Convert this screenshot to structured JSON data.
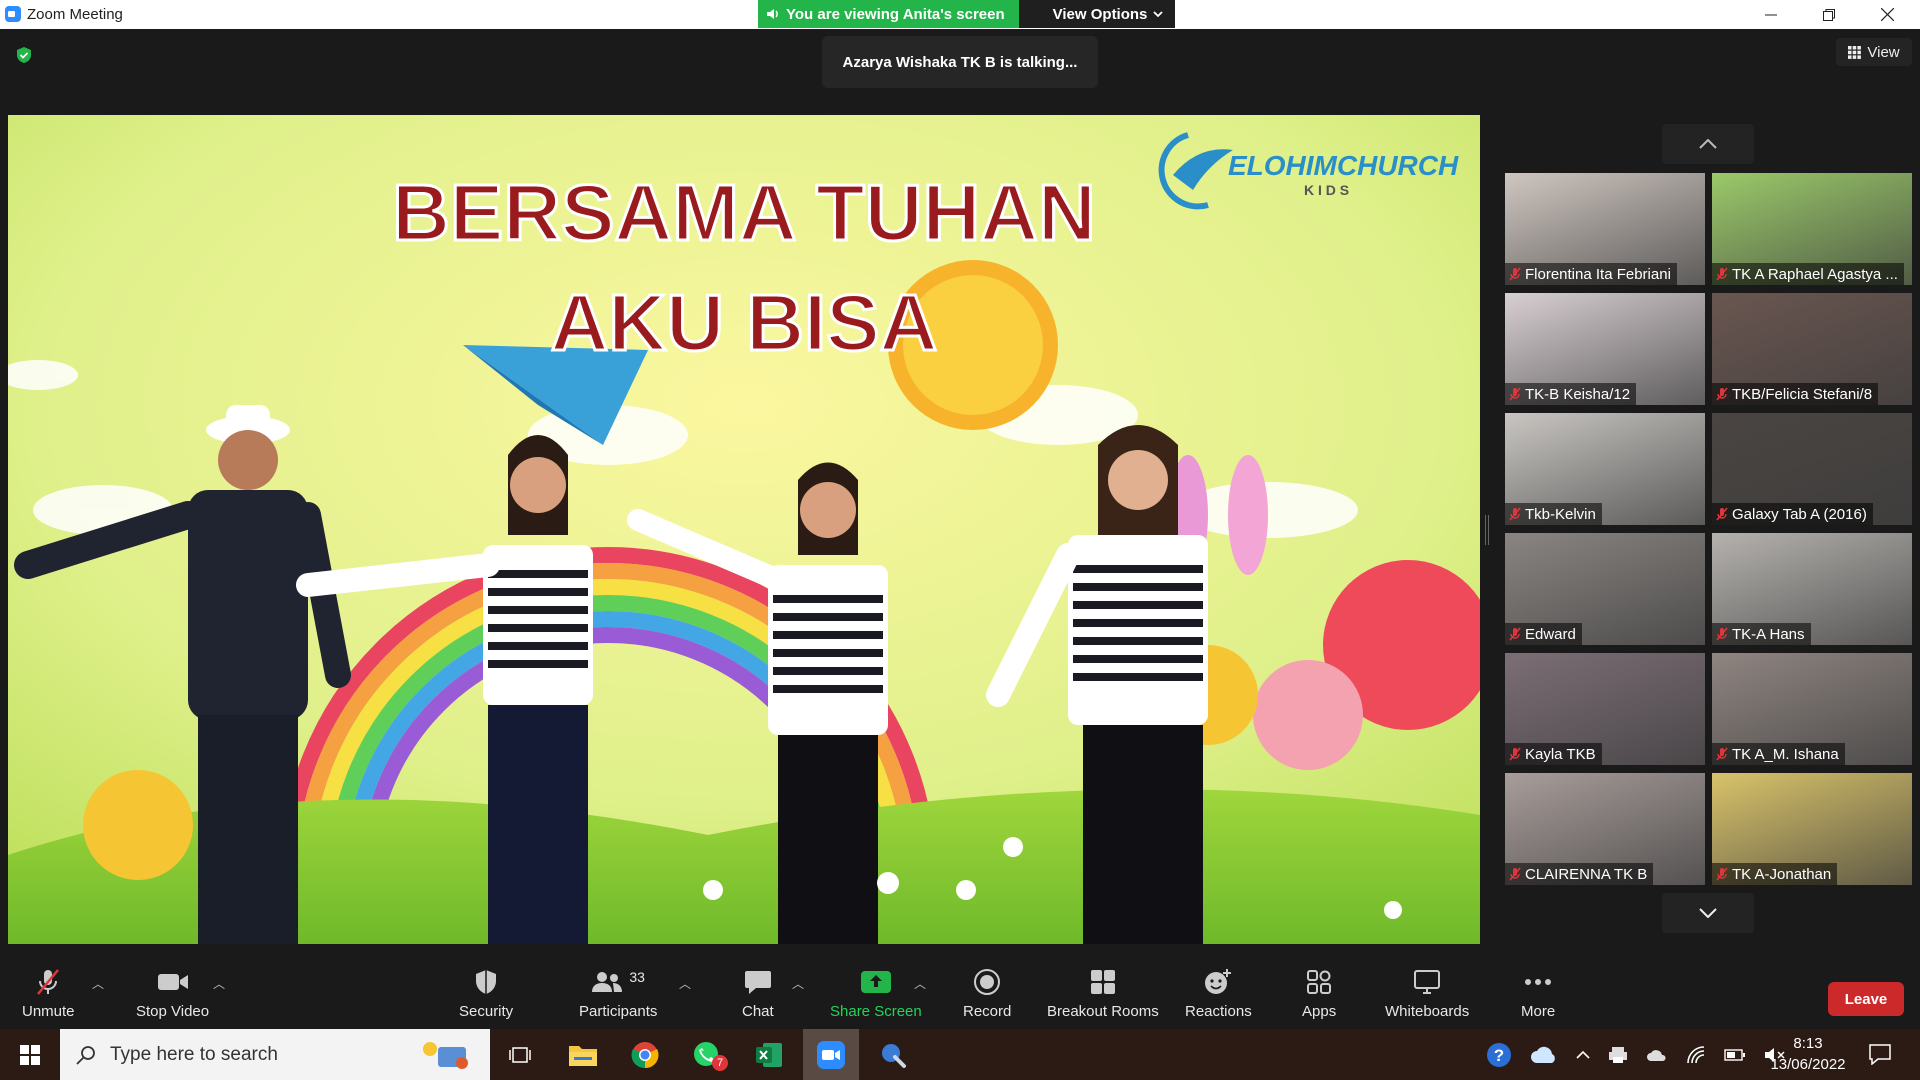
{
  "window": {
    "title": "Zoom Meeting",
    "controls": [
      "minimize",
      "restore",
      "close"
    ]
  },
  "share_banner": {
    "viewing_text": "You are viewing Anita's screen",
    "view_options_label": "View Options"
  },
  "talking_indicator": "Azarya Wishaka  TK B is talking...",
  "view_button_label": "View",
  "shared_content": {
    "title_line1": "BERSAMA TUHAN",
    "title_line2": "AKU BISA",
    "logo_main": "ELOHIMCHURCH",
    "logo_sub": "K I D S"
  },
  "gallery": {
    "participants": [
      {
        "name": "Florentina Ita Febriani",
        "muted": true,
        "bg": "#cfc6c0"
      },
      {
        "name": "TK A Raphael Agastya ...",
        "muted": true,
        "bg": "#9bc96a"
      },
      {
        "name": "TK-B Keisha/12",
        "muted": true,
        "bg": "#d8cfd2"
      },
      {
        "name": "TKB/Felicia Stefani/8",
        "muted": true,
        "bg": "#6a5650"
      },
      {
        "name": "Tkb-Kelvin",
        "muted": true,
        "bg": "#c9c6c2"
      },
      {
        "name": "Galaxy Tab A (2016)",
        "muted": true,
        "bg": "#4a4542"
      },
      {
        "name": "Edward",
        "muted": true,
        "bg": "#8a8582"
      },
      {
        "name": "TK-A Hans",
        "muted": true,
        "bg": "#b5b2ae"
      },
      {
        "name": "Kayla TKB",
        "muted": true,
        "bg": "#7c6e76"
      },
      {
        "name": "TK A_M. Ishana",
        "muted": true,
        "bg": "#8f8581"
      },
      {
        "name": "CLAIRENNA TK B",
        "muted": true,
        "bg": "#a89d9a"
      },
      {
        "name": "TK A-Jonathan",
        "muted": true,
        "bg": "#d9c36a"
      }
    ]
  },
  "toolbar": {
    "unmute": "Unmute",
    "stop_video": "Stop Video",
    "security": "Security",
    "participants": "Participants",
    "participants_count": "33",
    "chat": "Chat",
    "share_screen": "Share Screen",
    "record": "Record",
    "breakout_rooms": "Breakout Rooms",
    "reactions": "Reactions",
    "apps": "Apps",
    "whiteboards": "Whiteboards",
    "more": "More",
    "leave": "Leave"
  },
  "taskbar": {
    "search_placeholder": "Type here to search",
    "whatsapp_badge": "7",
    "time": "8:13",
    "date": "13/06/2022"
  },
  "colors": {
    "accent_green": "#23b54a",
    "leave_red": "#cc2a2a",
    "zoom_blue": "#2d8cff"
  }
}
